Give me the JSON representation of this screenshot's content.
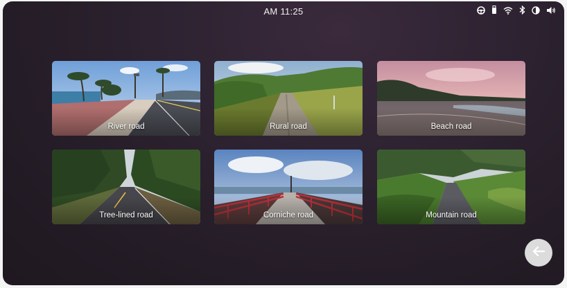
{
  "status_bar": {
    "time": "AM 11:25",
    "icons": [
      "steering-wheel-icon",
      "usb-icon",
      "wifi-icon",
      "bluetooth-icon",
      "brightness-icon",
      "volume-icon"
    ]
  },
  "roads": [
    {
      "label": "River road"
    },
    {
      "label": "Rural road"
    },
    {
      "label": "Beach road"
    },
    {
      "label": "Tree-lined road"
    },
    {
      "label": "Corniche road"
    },
    {
      "label": "Mountain road"
    }
  ],
  "navigation": {
    "back_icon": "arrow-left-icon"
  },
  "colors": {
    "background": "#2a2030",
    "text": "#ffffff",
    "back_button": "#dcdcdc"
  }
}
